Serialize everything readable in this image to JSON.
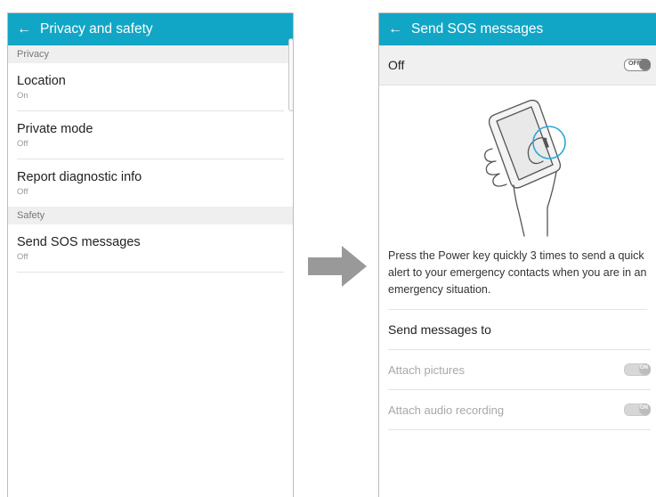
{
  "left_screen": {
    "title": "Privacy and safety",
    "back_icon": "back-arrow-icon",
    "sections": [
      {
        "header": "Privacy",
        "items": [
          {
            "label": "Location",
            "status": "On"
          },
          {
            "label": "Private mode",
            "status": "Off"
          },
          {
            "label": "Report diagnostic info",
            "status": "Off"
          }
        ]
      },
      {
        "header": "Safety",
        "items": [
          {
            "label": "Send SOS messages",
            "status": "Off"
          }
        ]
      }
    ]
  },
  "transition_icon": "right-arrow-icon",
  "right_screen": {
    "title": "Send SOS messages",
    "master_switch": {
      "label": "Off",
      "state_text": "OFF",
      "on": false
    },
    "illustration": "hand-holding-phone-power-key-icon",
    "description": "Press the Power key quickly 3 times to send a quick alert to your emergency contacts when you are in an emergency situation.",
    "send_to_label": "Send messages to",
    "options": [
      {
        "label": "Attach pictures",
        "switch_text": "ON",
        "on": true,
        "enabled": false
      },
      {
        "label": "Attach audio recording",
        "switch_text": "ON",
        "on": true,
        "enabled": false
      }
    ]
  },
  "colors": {
    "app_bar": "#12a6c6",
    "section_header_bg": "#efefef",
    "highlight_ring": "#2aa8d8",
    "arrow": "#999999"
  }
}
